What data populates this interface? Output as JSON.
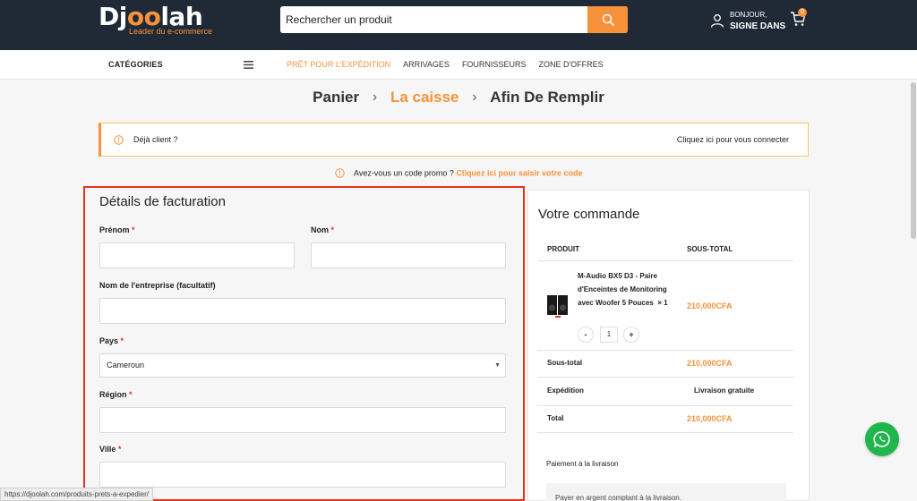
{
  "header": {
    "logo_prefix": "Dj",
    "logo_oo": "oo",
    "logo_suffix": "lah",
    "logo_tagline": "Leader du e-commerce",
    "search_placeholder": "Rechercher un produit",
    "user_greeting": "BONJOUR,",
    "user_signin": "SIGNE DANS",
    "cart_count": "0"
  },
  "nav": {
    "categories_label": "CATÉGORIES",
    "links": [
      "PRÊT POUR L'EXPÉDITION",
      "ARRIVAGES",
      "FOURNISSEURS",
      "ZONE D'OFFRES"
    ]
  },
  "steps": {
    "cart": "Panier",
    "checkout": "La caisse",
    "complete": "Afin De Remplir"
  },
  "notice": {
    "text": "Déjà client ?",
    "link": "Cliquez ici pour vous connecter"
  },
  "promo": {
    "text": "Avez-vous un code promo ?",
    "link": "Cliquez ici pour saisir votre code"
  },
  "billing": {
    "title": "Détails de facturation",
    "required_mark": "*",
    "first_name_label": "Prénom",
    "last_name_label": "Nom",
    "company_label": "Nom de l'entreprise (facultatif)",
    "country_label": "Pays",
    "country_value": "Cameroun",
    "region_label": "Région",
    "city_label": "Ville"
  },
  "order": {
    "title": "Votre commande",
    "col_product": "PRODUIT",
    "col_subtotal": "SOUS-TOTAL",
    "product_name": "M-Audio BX5 D3 - Paire d'Enceintes de Monitoring avec Woofer 5 Pouces",
    "product_qty_suffix": "× 1",
    "product_price": "210,000CFA",
    "qty_minus": "-",
    "qty_value": "1",
    "qty_plus": "+",
    "subtotal_label": "Sous-total",
    "subtotal_value": "210,000CFA",
    "shipping_label": "Expédition",
    "shipping_value": "Livraison gratuite",
    "total_label": "Total",
    "total_value": "210,000CFA",
    "payment_label": "Paiement à la livraison",
    "payment_desc": "Payer en argent comptant à la livraison."
  },
  "status_bar_url": "https://djoolah.com/produits-prets-a-expedier/",
  "colors": {
    "brand_orange": "#f7923a",
    "header_dark": "#1f2a36",
    "highlight_red": "#e8321d",
    "whatsapp_green": "#1fb64c"
  },
  "icons": [
    "search-icon",
    "user-icon",
    "cart-icon",
    "menu-icon",
    "info-icon",
    "chevron-right-icon",
    "chevron-down-icon",
    "whatsapp-icon"
  ]
}
